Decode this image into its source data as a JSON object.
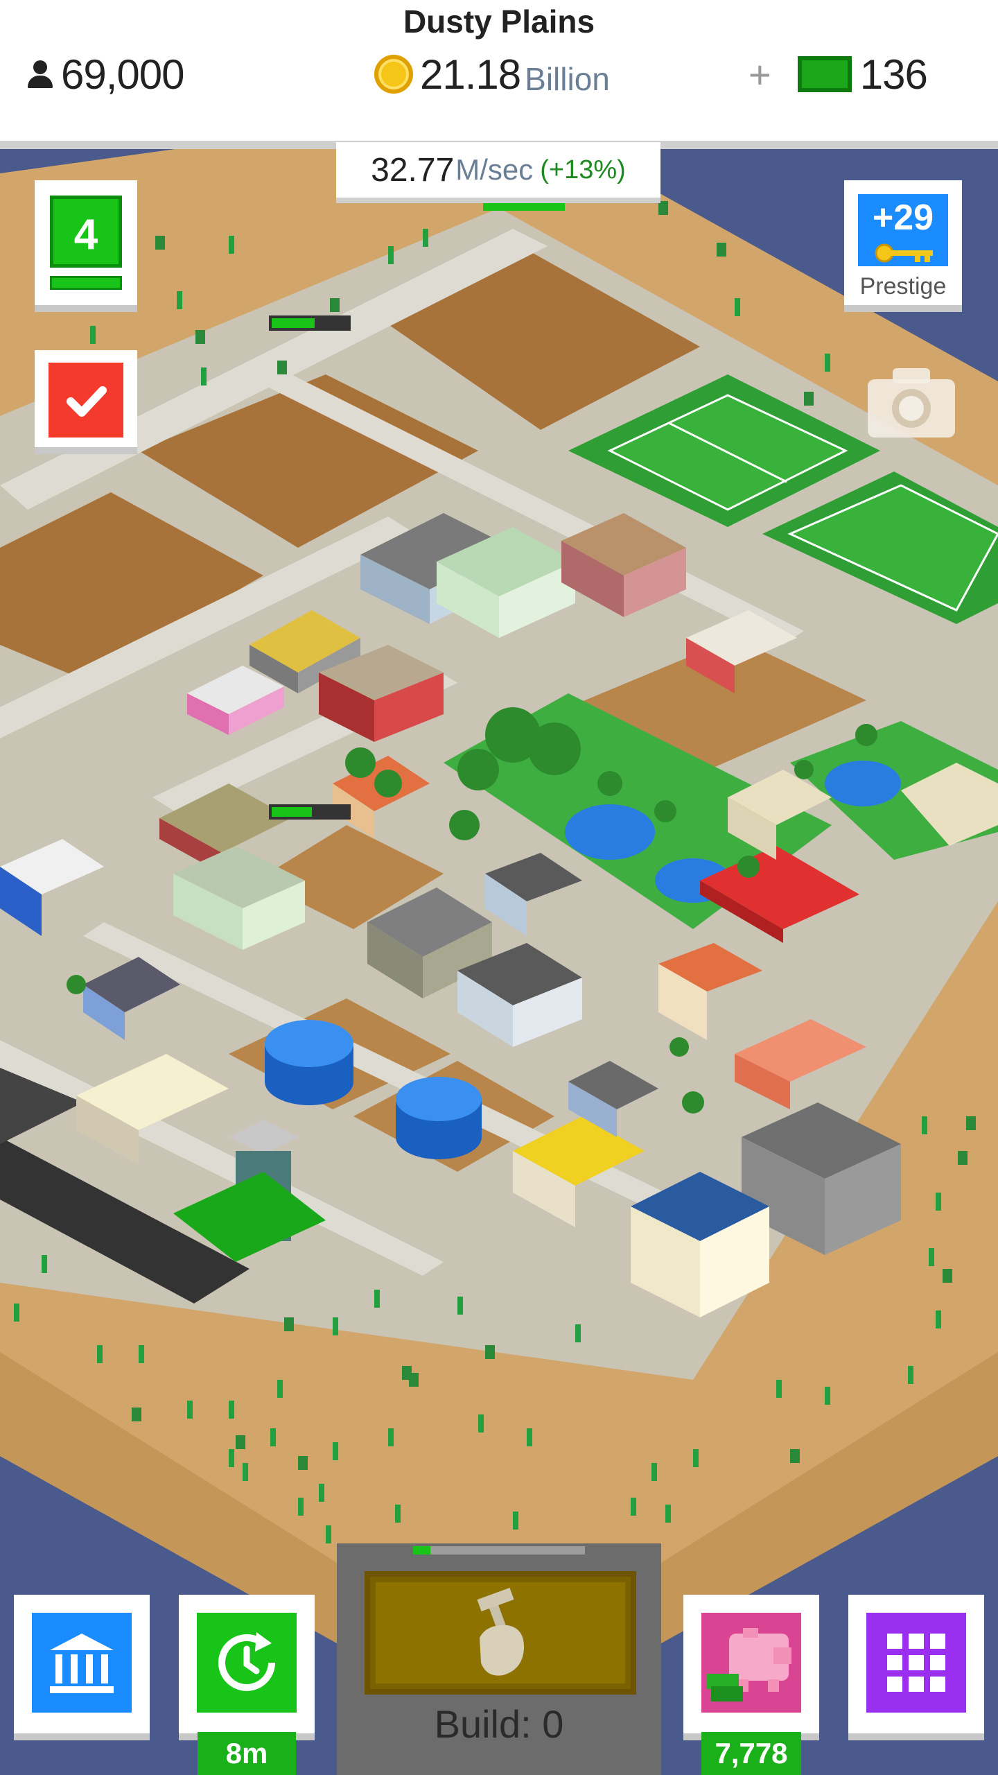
{
  "header": {
    "city_name": "Dusty Plains",
    "population": "69,000",
    "money_value": "21.18",
    "money_unit": "Billion",
    "plus": "+",
    "cash": "136"
  },
  "income": {
    "value": "32.77",
    "unit": "M/sec",
    "bonus": "(+13%)"
  },
  "level": {
    "number": "4"
  },
  "prestige": {
    "count": "+29",
    "label": "Prestige"
  },
  "build": {
    "label": "Build: 0",
    "progress": 0.1
  },
  "boost": {
    "timer": "8m"
  },
  "piggy_bank": {
    "amount": "7,778"
  },
  "icons": {
    "population": "person-icon",
    "money": "coin-icon",
    "cash": "cash-bill-icon",
    "tasks": "checkmark-icon",
    "prestige": "key-icon",
    "camera": "camera-icon",
    "bank": "bank-icon",
    "boost": "clock-refresh-icon",
    "build": "hammer-hand-icon",
    "piggy": "piggy-bank-icon",
    "menu": "grid-icon"
  },
  "colors": {
    "desert": "#d2a66a",
    "road": "#d9d6cc",
    "grass": "#35a83a",
    "water_outside": "#4a5a8c",
    "accent_green": "#19c419",
    "accent_blue": "#1a8cff",
    "accent_red": "#f43a2c",
    "accent_purple": "#9b2ff0",
    "accent_pink": "#d94593"
  }
}
